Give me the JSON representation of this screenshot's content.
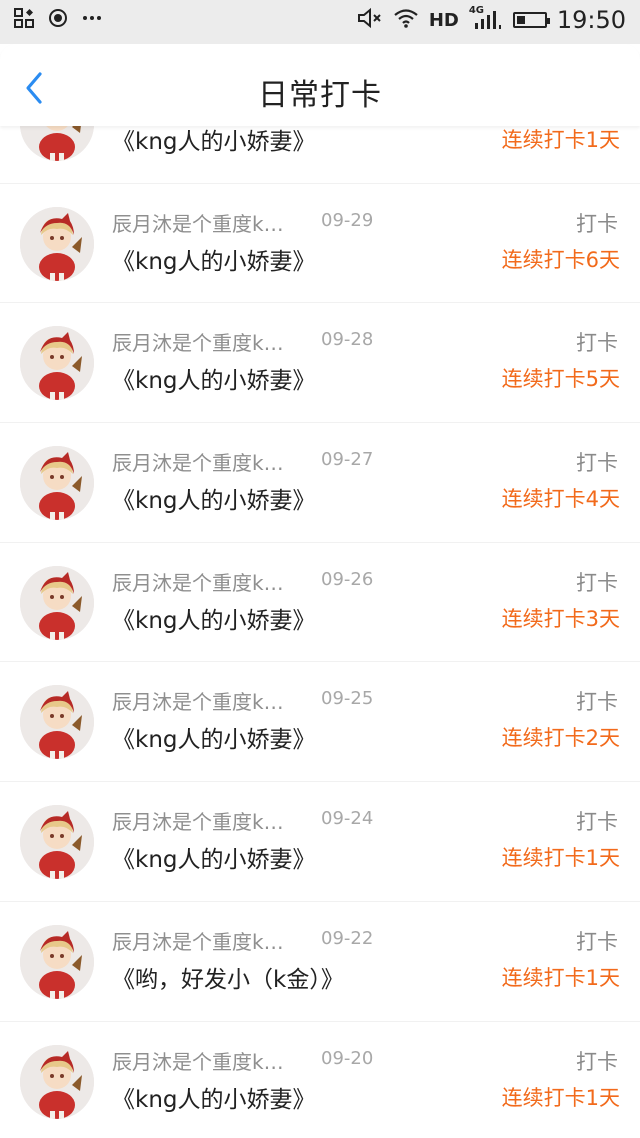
{
  "status_bar": {
    "left_icons": [
      "grid-icon",
      "record-icon",
      "more-icon"
    ],
    "network": "HD",
    "signal": "4G",
    "battery_level": 0.3,
    "time": "19:50"
  },
  "header": {
    "title": "日常打卡"
  },
  "colors": {
    "accent_blue": "#2b8cf1",
    "streak_orange": "#f26a1b",
    "meta_gray": "#8f8f8f"
  },
  "entries": [
    {
      "name": "",
      "date": "",
      "message": "《kng人的小娇妻》",
      "action": "",
      "streak": "连续打卡1天"
    },
    {
      "name": "辰月沐是个重度k…",
      "date": "09-29",
      "message": "《kng人的小娇妻》",
      "action": "打卡",
      "streak": "连续打卡6天"
    },
    {
      "name": "辰月沐是个重度k…",
      "date": "09-28",
      "message": "《kng人的小娇妻》",
      "action": "打卡",
      "streak": "连续打卡5天"
    },
    {
      "name": "辰月沐是个重度k…",
      "date": "09-27",
      "message": "《kng人的小娇妻》",
      "action": "打卡",
      "streak": "连续打卡4天"
    },
    {
      "name": "辰月沐是个重度k…",
      "date": "09-26",
      "message": "《kng人的小娇妻》",
      "action": "打卡",
      "streak": "连续打卡3天"
    },
    {
      "name": "辰月沐是个重度k…",
      "date": "09-25",
      "message": "《kng人的小娇妻》",
      "action": "打卡",
      "streak": "连续打卡2天"
    },
    {
      "name": "辰月沐是个重度k…",
      "date": "09-24",
      "message": "《kng人的小娇妻》",
      "action": "打卡",
      "streak": "连续打卡1天"
    },
    {
      "name": "辰月沐是个重度k…",
      "date": "09-22",
      "message": "《哟，好发小（k金）》",
      "action": "打卡",
      "streak": "连续打卡1天"
    },
    {
      "name": "辰月沐是个重度k…",
      "date": "09-20",
      "message": "《kng人的小娇妻》",
      "action": "打卡",
      "streak": "连续打卡1天"
    }
  ]
}
